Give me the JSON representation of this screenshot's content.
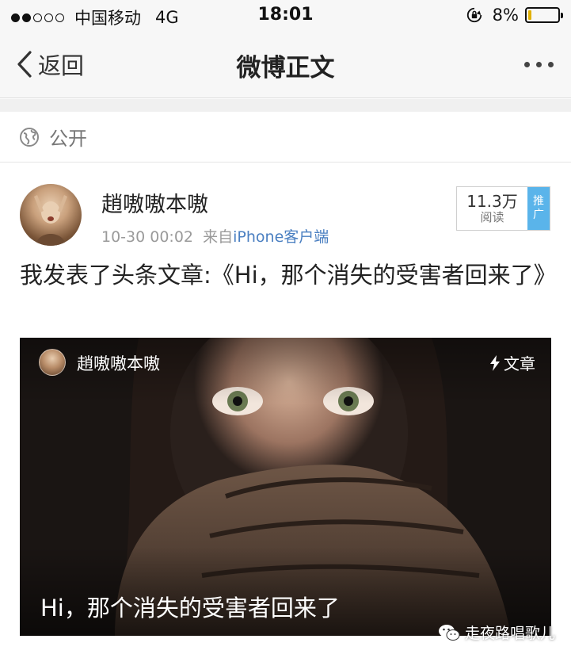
{
  "status_bar": {
    "carrier": "中国移动",
    "network": "4G",
    "time": "18:01",
    "battery": "8%",
    "signal_bars_filled": 2,
    "signal_bars_total": 5
  },
  "nav": {
    "back_label": "返回",
    "title": "微博正文"
  },
  "visibility": {
    "label": "公开",
    "icon": "globe-icon"
  },
  "post": {
    "author": "趙嗷嗷本嗷",
    "time": "10-30 00:02",
    "source_prefix": "来自",
    "source_client": "iPhone客户端",
    "reads_count": "11.3万",
    "reads_label": "阅读",
    "promote_line1": "推",
    "promote_line2": "广",
    "text": "我发表了头条文章:《Hi，那个消失的受害者回来了》"
  },
  "article_card": {
    "author": "趙嗷嗷本嗷",
    "tag": "文章",
    "title": "Hi，那个消失的受害者回来了"
  },
  "watermark": {
    "text": "走夜路唱歌儿"
  },
  "colors": {
    "link_blue": "#4a7fc1",
    "promote_blue": "#5ab4ea",
    "battery_low": "#e0b000"
  }
}
